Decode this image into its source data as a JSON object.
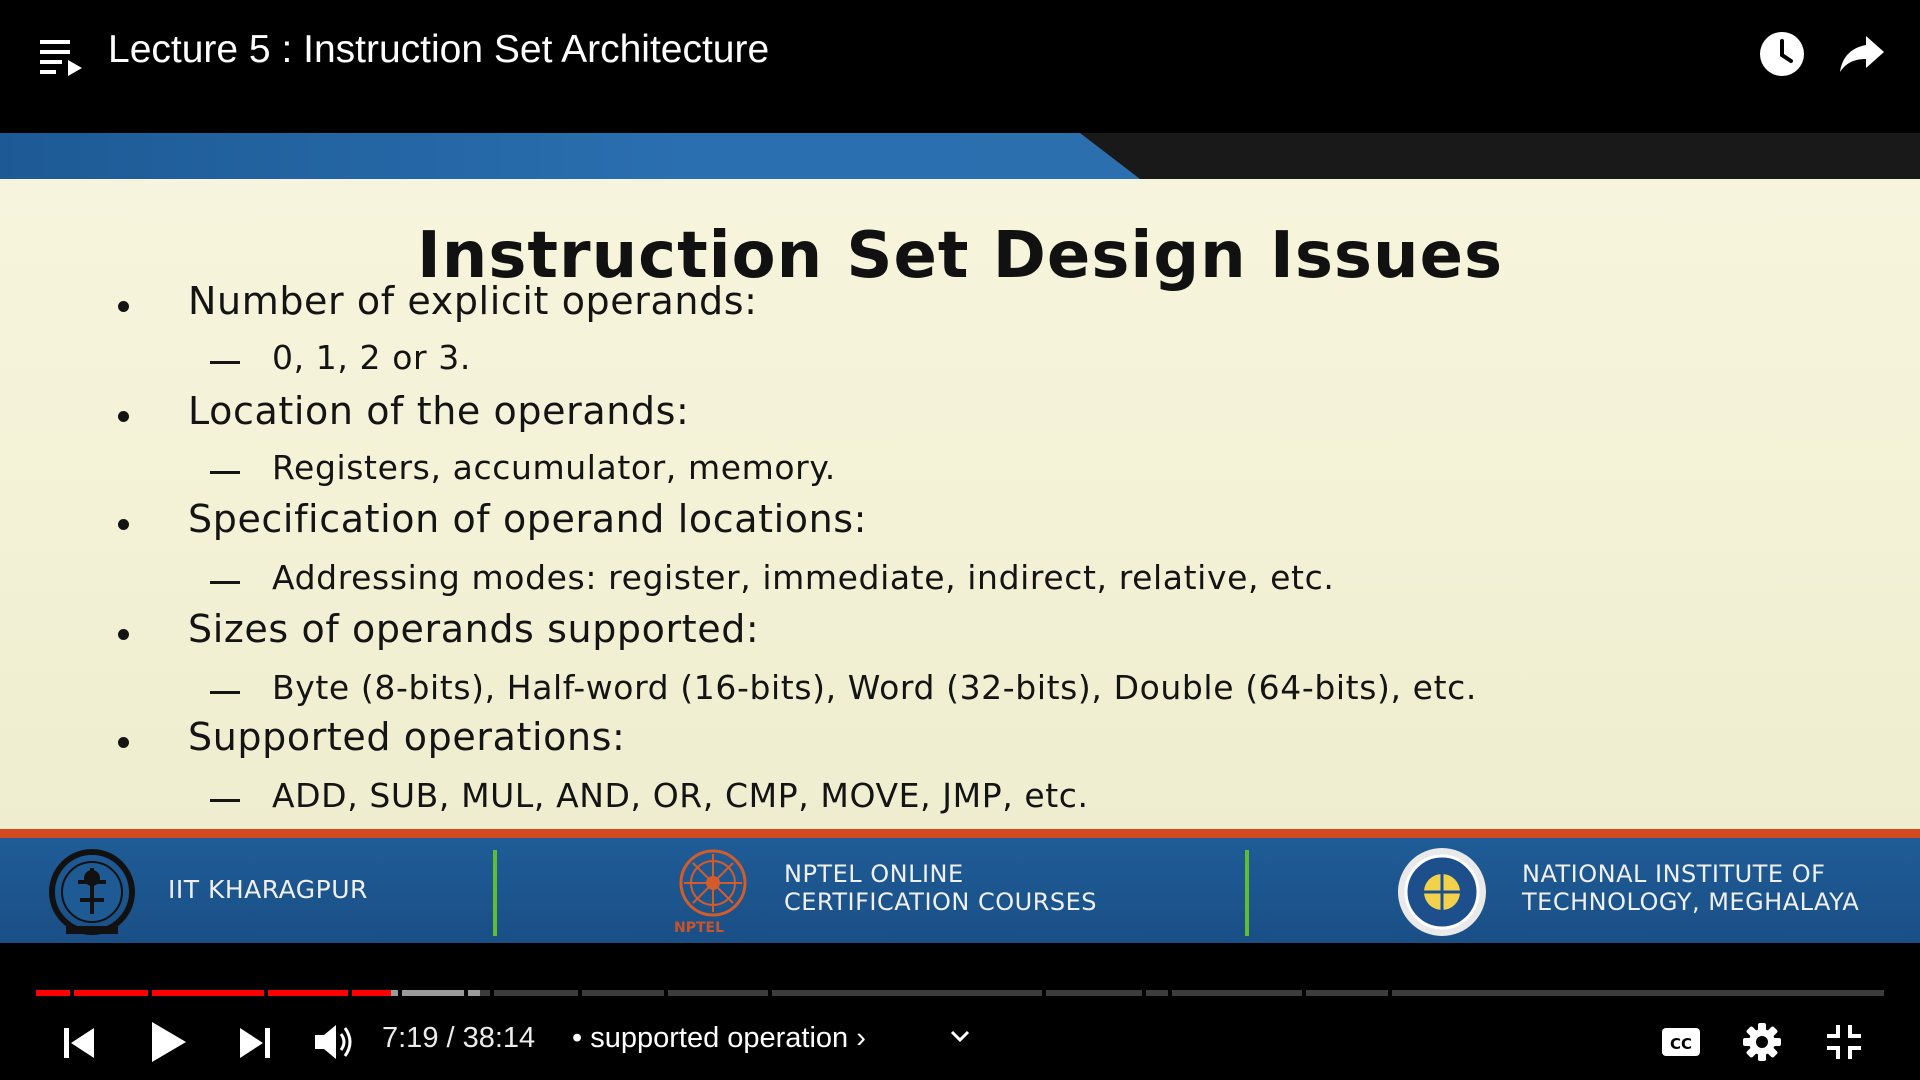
{
  "video": {
    "title": "Lecture 5 : Instruction Set Architecture"
  },
  "slide": {
    "title": "Instruction Set Design Issues",
    "bullets": [
      {
        "text": "Number of explicit operands:",
        "sub": "0, 1, 2 or 3."
      },
      {
        "text": "Location of the operands:",
        "sub": "Registers, accumulator, memory."
      },
      {
        "text": "Specification of operand locations:",
        "sub": "Addressing modes: register, immediate, indirect, relative, etc."
      },
      {
        "text": "Sizes of operands supported:",
        "sub": "Byte (8-bits), Half-word (16-bits), Word (32-bits), Double (64-bits), etc."
      },
      {
        "text": "Supported operations:",
        "sub": "ADD, SUB, MUL, AND, OR, CMP, MOVE, JMP, etc."
      }
    ],
    "footer": {
      "left": "IIT KHARAGPUR",
      "center_line1": "NPTEL ONLINE",
      "center_line2": "CERTIFICATION COURSES",
      "center_logo_caption": "NPTEL",
      "right_line1": "NATIONAL INSTITUTE OF",
      "right_line2": "TECHNOLOGY, MEGHALAYA"
    }
  },
  "player": {
    "time_display": "7:19 / 38:14",
    "chapter_label": "• supported operation ›",
    "progress_played_fraction": 0.192,
    "progress_buffered_fraction": 0.24,
    "colors": {
      "played": "#ff0000",
      "buffered": "#9a9a9a",
      "track": "#3c3c3c"
    }
  },
  "icons": {
    "top_left": "playlist-icon",
    "top_right": [
      "watch-later-icon",
      "share-icon"
    ],
    "controls_left": [
      "previous-icon",
      "play-icon",
      "next-icon",
      "volume-icon"
    ],
    "controls_right": [
      "captions-icon",
      "settings-icon",
      "exit-fullscreen-icon"
    ]
  }
}
